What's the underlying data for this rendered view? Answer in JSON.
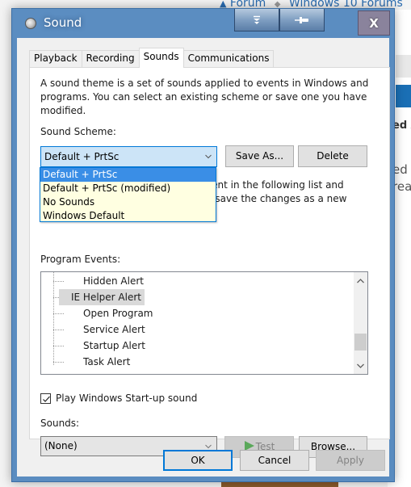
{
  "background": {
    "breadcrumb": [
      "Forum",
      "Windows 10 Forums"
    ],
    "snippet_bold": "ed A",
    "snippet_lines": [
      "ed c",
      "rea"
    ]
  },
  "window": {
    "title": "Sound",
    "close_label": "X"
  },
  "tabs": [
    {
      "label": "Playback",
      "active": false
    },
    {
      "label": "Recording",
      "active": false
    },
    {
      "label": "Sounds",
      "active": true
    },
    {
      "label": "Communications",
      "active": false
    }
  ],
  "sounds_tab": {
    "description": "A sound theme is a set of sounds applied to events in Windows and programs.  You can select an existing scheme or save one you have modified.",
    "scheme_label": "Sound Scheme:",
    "scheme_selected": "Default + PrtSc",
    "scheme_options": [
      {
        "label": "Default + PrtSc",
        "selected": true
      },
      {
        "label": "Default + PrtSc (modified)",
        "selected": false
      },
      {
        "label": "No Sounds",
        "selected": false
      },
      {
        "label": "Windows Default",
        "selected": false
      }
    ],
    "save_as_label": "Save As...",
    "delete_label": "Delete",
    "hidden_desc_line1": "vent in the following list and",
    "hidden_desc_line2": "n save the changes as a new",
    "program_events_label": "Program Events:",
    "events": [
      {
        "label": "Hidden Alert",
        "selected": false
      },
      {
        "label": "IE Helper Alert",
        "selected": true
      },
      {
        "label": "Open Program",
        "selected": false
      },
      {
        "label": "Service Alert",
        "selected": false
      },
      {
        "label": "Startup Alert",
        "selected": false
      },
      {
        "label": "Task Alert",
        "selected": false
      }
    ],
    "scroll_position": 0.85,
    "startup_sound_label": "Play Windows Start-up sound",
    "startup_sound_checked": true,
    "sounds_label": "Sounds:",
    "sound_selected": "(None)",
    "test_label": "Test",
    "browse_label": "Browse..."
  },
  "footer": {
    "ok_label": "OK",
    "cancel_label": "Cancel",
    "apply_label": "Apply"
  }
}
